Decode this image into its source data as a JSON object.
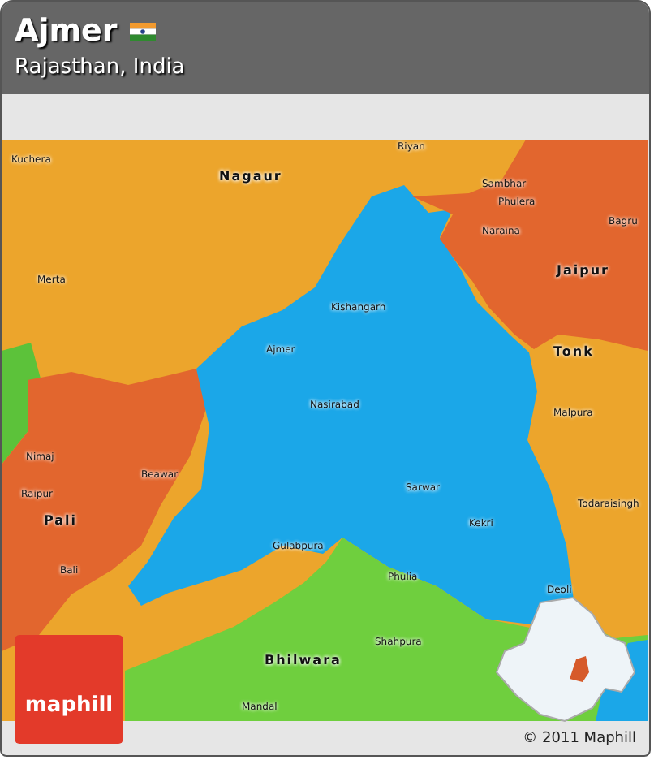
{
  "header": {
    "title": "Ajmer",
    "subtitle": "Rajasthan, India"
  },
  "map": {
    "labels": [
      {
        "text": "Kuchera",
        "kind": "town"
      },
      {
        "text": "Nagaur",
        "kind": "district"
      },
      {
        "text": "Merta",
        "kind": "town"
      },
      {
        "text": "Riyan",
        "kind": "town"
      },
      {
        "text": "Sambhar",
        "kind": "town"
      },
      {
        "text": "Phulera",
        "kind": "town"
      },
      {
        "text": "Naraina",
        "kind": "town"
      },
      {
        "text": "Bagru",
        "kind": "town"
      },
      {
        "text": "Jaipur",
        "kind": "district"
      },
      {
        "text": "Kishangarh",
        "kind": "town"
      },
      {
        "text": "Ajmer",
        "kind": "town"
      },
      {
        "text": "Nasirabad",
        "kind": "town"
      },
      {
        "text": "Tonk",
        "kind": "district"
      },
      {
        "text": "Malpura",
        "kind": "town"
      },
      {
        "text": "Nimaj",
        "kind": "town"
      },
      {
        "text": "Beawar",
        "kind": "town"
      },
      {
        "text": "Raipur",
        "kind": "town"
      },
      {
        "text": "Pali",
        "kind": "district"
      },
      {
        "text": "Bali",
        "kind": "town"
      },
      {
        "text": "Gulabpura",
        "kind": "town"
      },
      {
        "text": "Sarwar",
        "kind": "town"
      },
      {
        "text": "Kekri",
        "kind": "town"
      },
      {
        "text": "Todaraisingh",
        "kind": "town"
      },
      {
        "text": "Phulia",
        "kind": "town"
      },
      {
        "text": "Deoli",
        "kind": "town"
      },
      {
        "text": "Shahpura",
        "kind": "town"
      },
      {
        "text": "Bhilwara",
        "kind": "district"
      },
      {
        "text": "Mandal",
        "kind": "town"
      }
    ]
  },
  "logo": "maphill",
  "copyright": "© 2011 Maphill"
}
